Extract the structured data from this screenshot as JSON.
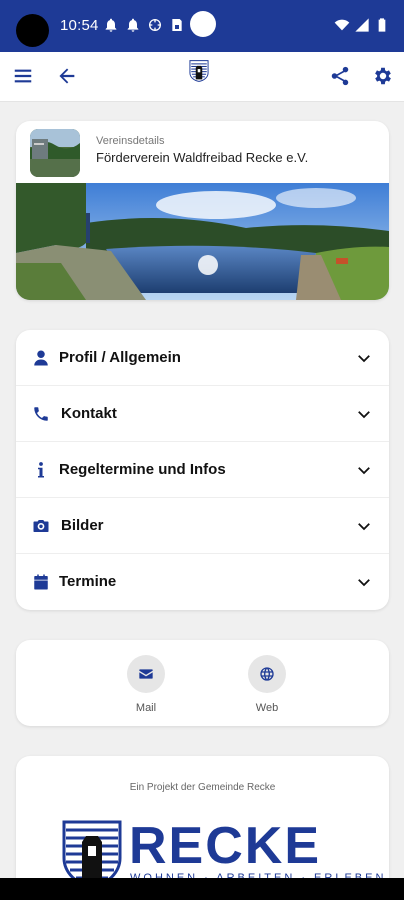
{
  "status_bar": {
    "time": "10:54",
    "icons": [
      "bell-icon",
      "bell-icon",
      "crosshair-icon",
      "sim-icon"
    ],
    "right_icons": [
      "wifi-icon",
      "signal-icon",
      "battery-icon"
    ]
  },
  "app_bar": {
    "menu_icon": "menu-icon",
    "back_icon": "arrow-left-icon",
    "share_icon": "share-icon",
    "settings_icon": "gear-icon"
  },
  "club": {
    "label": "Vereinsdetails",
    "name": "Förderverein Waldfreibad Recke e.V."
  },
  "sections": [
    {
      "label": "Profil / Allgemein",
      "icon": "user-icon"
    },
    {
      "label": "Kontakt",
      "icon": "phone-icon"
    },
    {
      "label": "Regeltermine und Infos",
      "icon": "info-icon"
    },
    {
      "label": "Bilder",
      "icon": "camera-icon"
    },
    {
      "label": "Termine",
      "icon": "calendar-icon"
    }
  ],
  "links": [
    {
      "label": "Mail",
      "icon": "mail-icon"
    },
    {
      "label": "Web",
      "icon": "globe-icon"
    }
  ],
  "project": {
    "text": "Ein Projekt der Gemeinde Recke",
    "wordmark": "RECKE",
    "tagline": "WOHNEN · ARBEITEN · ERLEBEN"
  },
  "colors": {
    "primary": "#1e3a96",
    "background": "#f0f0f0",
    "card": "#ffffff"
  }
}
